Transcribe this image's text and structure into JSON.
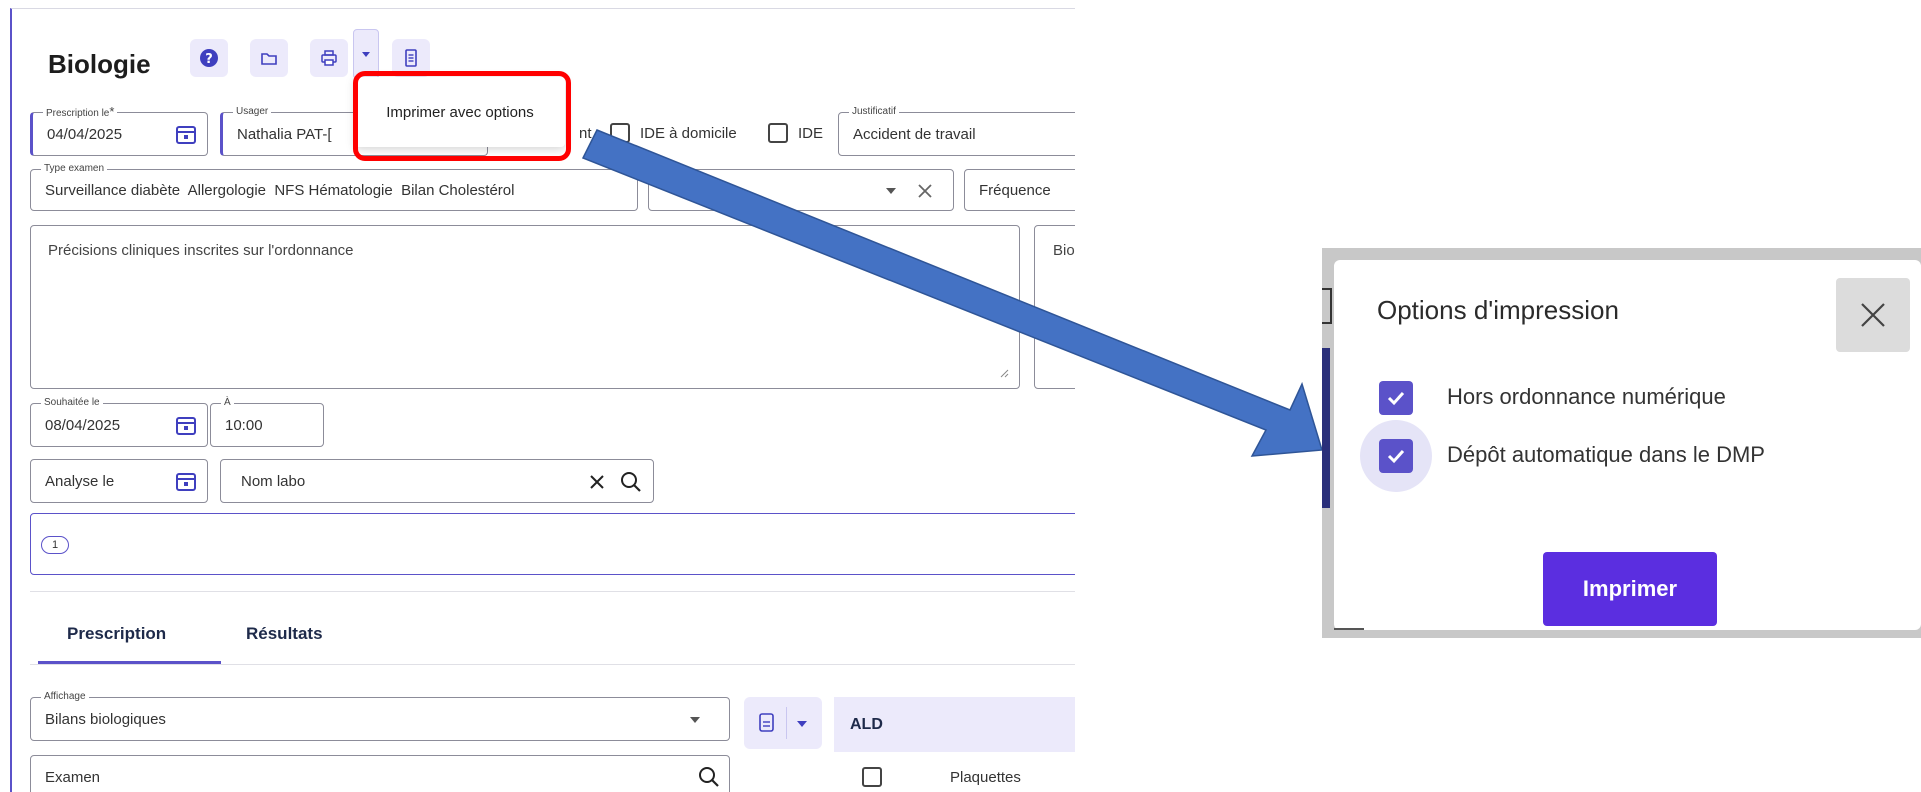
{
  "header": {
    "title": "Biologie",
    "icons": [
      "help-icon",
      "folder-icon",
      "printer-icon",
      "caret-down-icon",
      "document-icon"
    ]
  },
  "dropdown": {
    "item_label": "Imprimer avec options"
  },
  "form": {
    "prescription_label": "Prescription le",
    "prescription_required": "*",
    "prescription_value": "04/04/2025",
    "usager_label": "Usager",
    "usager_value": "Nathalia PAT-[",
    "partial_checkbox_label": "nt",
    "ide_domicile_label": "IDE à domicile",
    "ide_label": "IDE",
    "justificatif_label": "Justificatif",
    "justificatif_value": "Accident de travail",
    "type_examen_label": "Type examen",
    "type_examen_tags": [
      "Surveillance diabète",
      "Allergologie",
      "NFS Hématologie",
      "Bilan Cholestérol"
    ],
    "frequence_label": "Fréquence",
    "precisions_placeholder": "Précisions cliniques inscrites sur l'ordonnance",
    "bio_partial": "Bio",
    "souhaitee_label": "Souhaitée le",
    "souhaitee_value": "08/04/2025",
    "a_label": "À",
    "a_value": "10:00",
    "analyse_placeholder": "Analyse le",
    "nom_labo_placeholder": "Nom labo",
    "badge_count": "1"
  },
  "tabs": [
    {
      "label": "Prescription",
      "active": true
    },
    {
      "label": "Résultats",
      "active": false
    }
  ],
  "bottom": {
    "affichage_label": "Affichage",
    "affichage_value": "Bilans biologiques",
    "examen_placeholder": "Examen",
    "ald_header": "ALD",
    "plaquettes_label": "Plaquettes"
  },
  "modal": {
    "title": "Options d'impression",
    "options": [
      {
        "label": "Hors ordonnance numérique",
        "checked": true
      },
      {
        "label": "Dépôt automatique dans le DMP",
        "checked": true
      }
    ],
    "print_button": "Imprimer"
  },
  "colors": {
    "accent": "#5b52c9",
    "print_button": "#5b2ee0",
    "annotation_red": "#ff0000",
    "annotation_arrow": "#4472c4"
  }
}
